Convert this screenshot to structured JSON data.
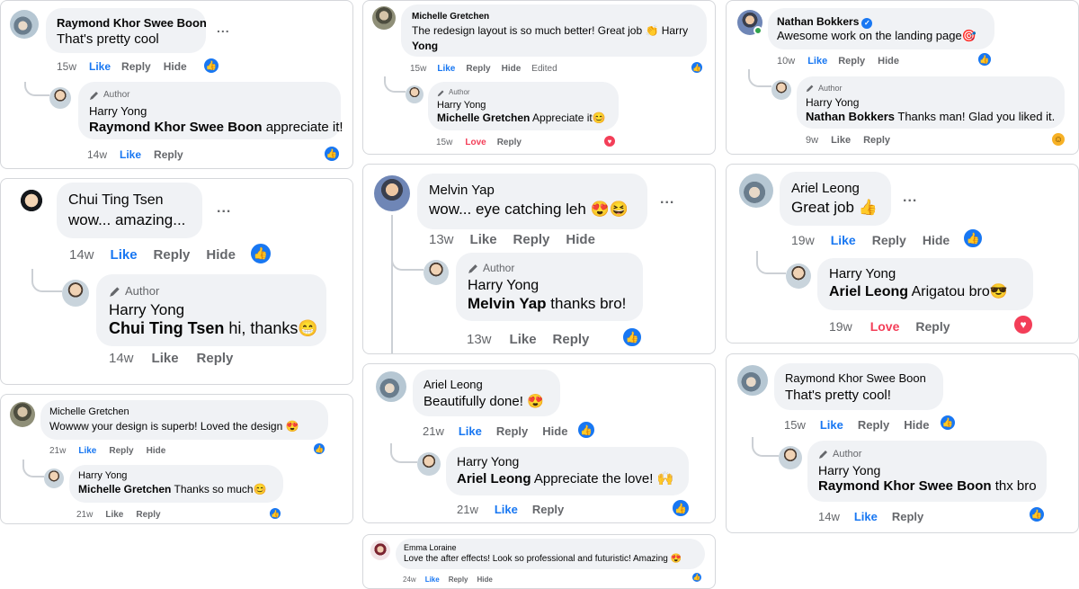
{
  "common": {
    "like": "Like",
    "reply": "Reply",
    "hide": "Hide",
    "love": "Love",
    "edited": "Edited",
    "author": "Author",
    "more": "..."
  },
  "cards": [
    {
      "name": "Raymond Khor Swee Boon",
      "text": "That's pretty cool",
      "time": "15w",
      "reply": {
        "name": "Harry Yong",
        "mention": "Raymond Khor Swee Boon",
        "text": "appreciate it!",
        "time": "14w"
      }
    },
    {
      "name": "Michelle Gretchen",
      "text": "The redesign layout is so much better! Great job 👏 Harry",
      "text2": "Yong",
      "time": "15w",
      "reply": {
        "name": "Harry Yong",
        "mention": "Michelle Gretchen",
        "text": "Appreciate it😊",
        "time": "15w"
      }
    },
    {
      "name": "Nathan Bokkers",
      "text": "Awesome work on the landing page🎯",
      "time": "10w",
      "reply": {
        "name": "Harry Yong",
        "mention": "Nathan Bokkers",
        "text": "Thanks man! Glad you liked it.",
        "time": "9w"
      }
    },
    {
      "name": "Chui Ting Tsen",
      "text": "wow... amazing...",
      "time": "14w",
      "reply": {
        "name": "Harry Yong",
        "mention": "Chui Ting Tsen",
        "text": "hi, thanks😁",
        "time": "14w"
      }
    },
    {
      "name": "Melvin Yap",
      "text": "wow... eye catching leh 😍😆",
      "time": "13w",
      "reply": {
        "name": "Harry Yong",
        "mention": "Melvin Yap",
        "text": "thanks bro!",
        "time": "13w"
      }
    },
    {
      "name": "Ariel Leong",
      "text": "Great job 👍",
      "time": "19w",
      "reply": {
        "name": "Harry Yong",
        "mention": "Ariel Leong",
        "text": "Arigatou bro😎",
        "time": "19w"
      }
    },
    {
      "name": "Michelle Gretchen",
      "text": "Wowww your design is superb! Loved the design 😍",
      "time": "21w",
      "reply": {
        "name": "Harry Yong",
        "mention": "Michelle Gretchen",
        "text": "Thanks so much😊",
        "time": "21w"
      }
    },
    {
      "name": "Ariel Leong",
      "text": "Beautifully done! 😍",
      "time": "21w",
      "reply": {
        "name": "Harry Yong",
        "mention": "Ariel Leong",
        "text": "Appreciate the love! 🙌",
        "time": "21w"
      }
    },
    {
      "name": "Raymond Khor Swee Boon",
      "text": "That's pretty cool!",
      "time": "15w",
      "reply": {
        "name": "Harry Yong",
        "mention": "Raymond Khor Swee Boon",
        "text": "thx bro",
        "time": "14w"
      }
    },
    {
      "name": "Emma Loraine",
      "text": "Love the after effects! Look so professional and futuristic! Amazing 😍",
      "time": "24w"
    }
  ]
}
